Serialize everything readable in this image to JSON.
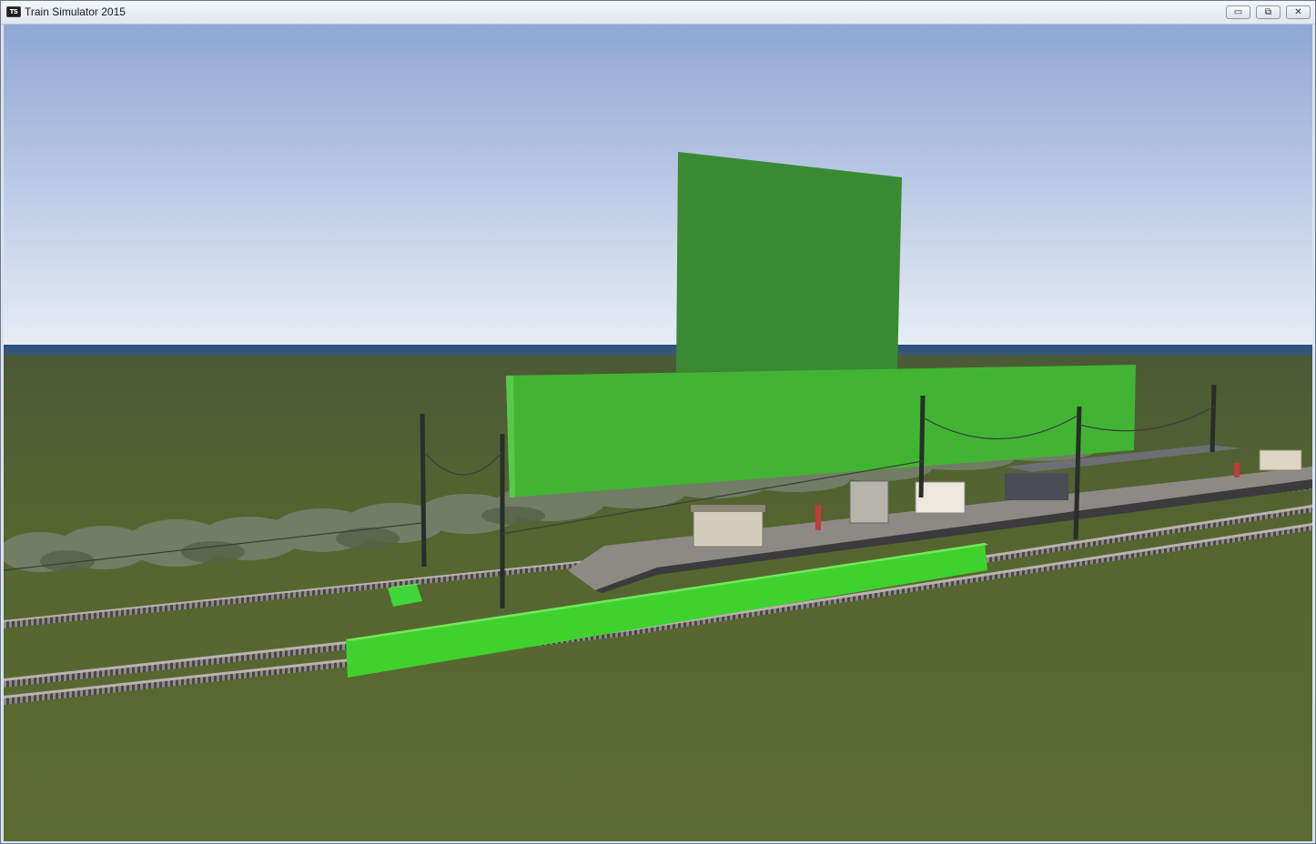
{
  "window": {
    "title": "Train Simulator 2015",
    "app_icon_text": "TS",
    "controls": [
      {
        "name": "minimize-button",
        "icon": "minimize-icon",
        "glyph": "▭"
      },
      {
        "name": "restore-button",
        "icon": "restore-icon",
        "glyph": "⧉"
      },
      {
        "name": "close-button",
        "icon": "close-icon",
        "glyph": "✕"
      }
    ]
  },
  "scene": {
    "description_objects": [
      "sky",
      "sea-horizon",
      "grass-terrain",
      "railway-tracks",
      "station-platform",
      "overhead-catenary-masts",
      "green-placeholder-blocks",
      "shrub-line"
    ],
    "colors": {
      "sky_top": "#8fa7d4",
      "sky_bottom": "#dfe7f1",
      "sea": "#2b4f7f",
      "grass": "#5b6a34",
      "placeholder_green": "#3fb52e",
      "placeholder_green_dark": "#3a8a34"
    }
  }
}
